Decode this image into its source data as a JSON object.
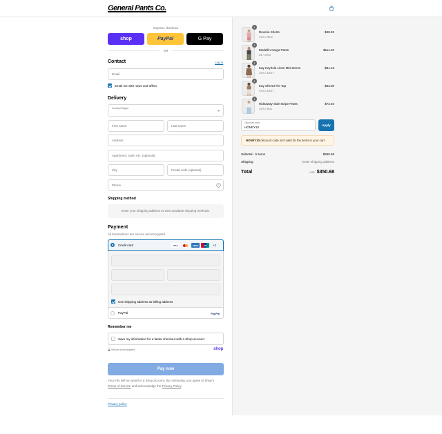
{
  "header": {
    "store_name": "General Pants Co."
  },
  "express": {
    "title": "Express checkout",
    "shop_label": "shop",
    "paypal_label": "PayPal",
    "gpay_label": "G Pay",
    "or_label": "OR"
  },
  "contact": {
    "heading": "Contact",
    "login_link": "Log in",
    "email_placeholder": "Email",
    "newsletter_label": "Email me with news and offers"
  },
  "delivery": {
    "heading": "Delivery",
    "country_label": "Country/Region",
    "first_name": "First name",
    "last_name": "Last name",
    "address": "Address",
    "apartment": "Apartment, suite, etc. (optional)",
    "city": "City",
    "postal": "Postal code (optional)",
    "phone": "Phone"
  },
  "shipping": {
    "heading": "Shipping method",
    "message": "Enter your shipping address to view available shipping methods."
  },
  "payment": {
    "heading": "Payment",
    "subtitle": "All transactions are secure and encrypted.",
    "credit_card_label": "Credit card",
    "more_cards": "+1",
    "billing_label": "Use shipping address as billing address",
    "paypal_label": "PayPal",
    "card_brands": [
      "VISA",
      "MC",
      "AMEX",
      "UP"
    ]
  },
  "remember": {
    "heading": "Remember me",
    "save_label": "Save my information for a faster checkout with a Shop account",
    "secure_label": "Secure and encrypted",
    "shop_brand": "shop"
  },
  "pay_button": "Pay now",
  "legal": {
    "line1": "Your info will be saved to a Shop account. By continuing, you agree to Shop's",
    "terms": "Terms of Service",
    "middle": " and acknowledge the ",
    "privacy": "Privacy Policy",
    "end": "."
  },
  "footer": {
    "privacy_policy": "Privacy policy"
  },
  "cart": {
    "items": [
      {
        "name": "Reverie Shorts",
        "variant": "XXS / RED",
        "price": "$48.92",
        "qty": "1"
      },
      {
        "name": "Medellin Cargo Pants",
        "variant": "24 / GRN",
        "price": "$114.20",
        "qty": "1"
      },
      {
        "name": "Kay Keyhole Linen Mini Dress",
        "variant": "XXS / ASST",
        "price": "$61.16",
        "qty": "1"
      },
      {
        "name": "Kay Shirred Tie Top",
        "variant": "XXS / ASST",
        "price": "$53.00",
        "qty": "1"
      },
      {
        "name": "Hideaway Side Stripe Pants",
        "variant": "XXS / BLU",
        "price": "$73.40",
        "qty": "1"
      }
    ],
    "discount_label": "Discount code",
    "discount_value": "HONEY10",
    "apply_label": "Apply",
    "discount_error_code": "HONEY10",
    "discount_error_text": " discount code isn't valid for the items in your cart",
    "subtotal_label": "Subtotal · 5 items",
    "subtotal_value": "$350.68",
    "shipping_label": "Shipping",
    "shipping_value": "Enter shipping address",
    "total_label": "Total",
    "currency": "USD",
    "total_value": "$350.68"
  },
  "colors": {
    "shop_purple": "#5a31f4",
    "paypal_yellow": "#ffc439",
    "accent_blue": "#1773b0",
    "pay_button": "#82abe3"
  }
}
